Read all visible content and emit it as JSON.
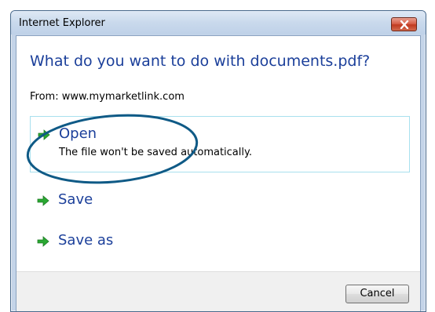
{
  "window": {
    "title": "Internet Explorer",
    "close_icon": "close-icon"
  },
  "prompt": {
    "question": "What do you want to do with documents.pdf?",
    "from": "From: www.mymarketlink.com"
  },
  "options": [
    {
      "label": "Open",
      "description": "The file won't be saved automatically.",
      "icon": "green-arrow-icon"
    },
    {
      "label": "Save",
      "icon": "green-arrow-icon"
    },
    {
      "label": "Save as",
      "icon": "green-arrow-icon"
    }
  ],
  "footer": {
    "cancel_label": "Cancel"
  },
  "colors": {
    "link_blue": "#1b3f9a",
    "arrow_green": "#2aa832",
    "highlight_ellipse": "#0f5a86",
    "close_red": "#c03a20"
  }
}
